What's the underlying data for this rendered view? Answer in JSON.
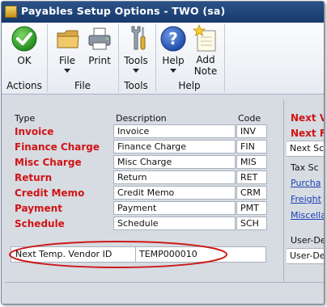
{
  "window": {
    "title": "Payables Setup Options  -  TWO (sa)"
  },
  "ribbon": {
    "ok": "OK",
    "file": "File",
    "print": "Print",
    "tools": "Tools",
    "help": "Help",
    "add_note_1": "Add",
    "add_note_2": "Note",
    "groups": {
      "actions": "Actions",
      "file": "File",
      "tools": "Tools",
      "help": "Help"
    }
  },
  "table": {
    "headers": {
      "type": "Type",
      "description": "Description",
      "code": "Code"
    },
    "rows": [
      {
        "type": "Invoice",
        "description": "Invoice",
        "code": "INV"
      },
      {
        "type": "Finance Charge",
        "description": "Finance Charge",
        "code": "FIN"
      },
      {
        "type": "Misc Charge",
        "description": "Misc Charge",
        "code": "MIS"
      },
      {
        "type": "Return",
        "description": "Return",
        "code": "RET"
      },
      {
        "type": "Credit Memo",
        "description": "Credit  Memo",
        "code": "CRM"
      },
      {
        "type": "Payment",
        "description": "Payment",
        "code": "PMT"
      },
      {
        "type": "Schedule",
        "description": "Schedule",
        "code": "SCH"
      }
    ]
  },
  "vendor": {
    "label": "Next Temp. Vendor ID",
    "value": "TEMP000010"
  },
  "right_panel": {
    "next_v": "Next V",
    "next_f": "Next F",
    "next_sc": "Next Sc",
    "tax_sc": "Tax Sc",
    "purcha": "Purcha",
    "freight": "Freight",
    "miscella": "Miscella",
    "user_de_1": "User-De",
    "user_de_2": "User-De"
  },
  "colors": {
    "type_label": "#d11414",
    "title_bar": "#1f4478",
    "link": "#1a3fb4",
    "highlight_ellipse": "#cc1a1a"
  }
}
